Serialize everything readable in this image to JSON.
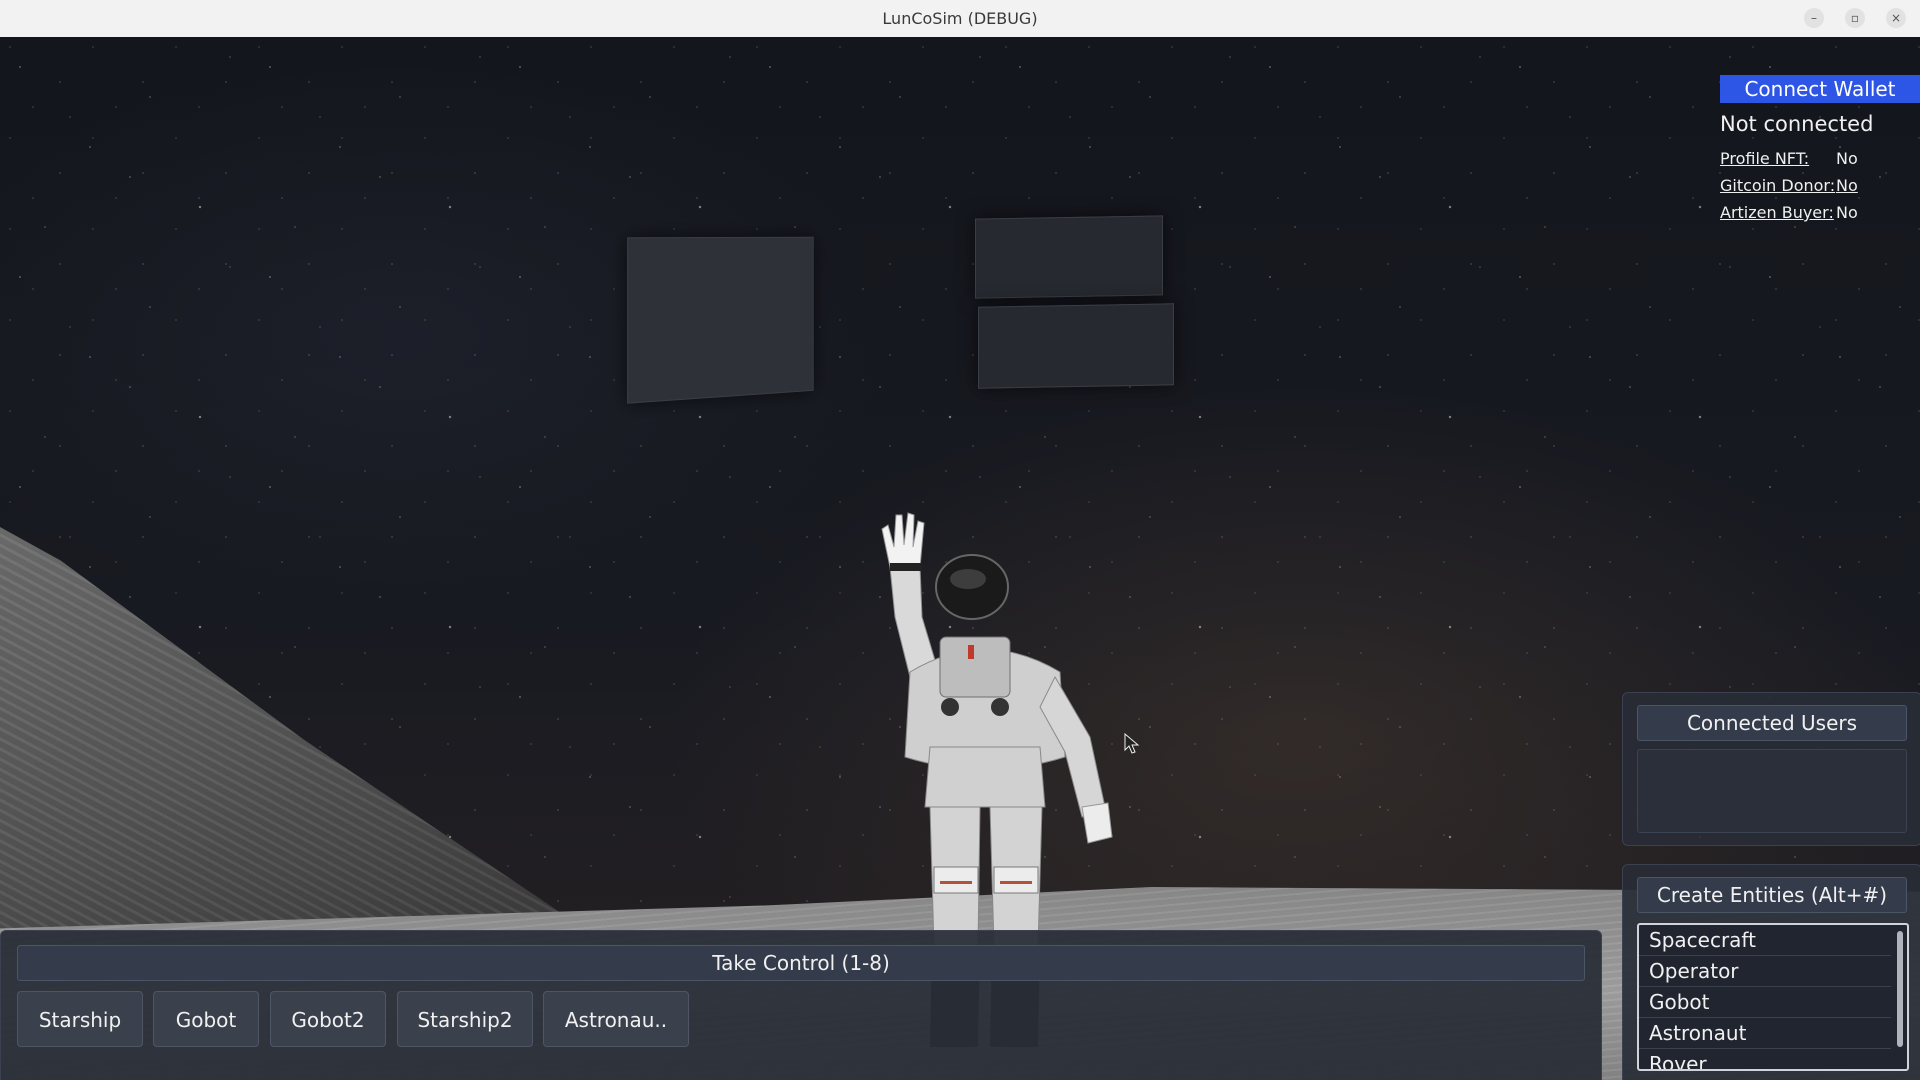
{
  "window": {
    "title": "LunCoSim (DEBUG)",
    "controls": {
      "minimize": "–",
      "maximize": "▫",
      "close": "×"
    }
  },
  "wallet": {
    "connect_label": "Connect Wallet",
    "status": "Not connected",
    "accent_color": "#2d55e6",
    "fields": [
      {
        "label": "Profile NFT:",
        "value": "No"
      },
      {
        "label": "Gitcoin Donor:",
        "value": "No"
      },
      {
        "label": "Artizen Buyer:",
        "value": "No"
      }
    ]
  },
  "users_panel": {
    "header": "Connected Users"
  },
  "entities_panel": {
    "header": "Create Entities (Alt+#)",
    "items": [
      "Spacecraft",
      "Operator",
      "Gobot",
      "Astronaut",
      "Rover"
    ]
  },
  "control_panel": {
    "header": "Take Control (1-8)",
    "buttons": [
      "Starship",
      "Gobot",
      "Gobot2",
      "Starship2",
      "Astronau.."
    ]
  },
  "icons": {
    "cursor": "mouse-pointer-icon",
    "close": "close-icon",
    "minimize": "minimize-icon",
    "maximize": "maximize-icon"
  }
}
